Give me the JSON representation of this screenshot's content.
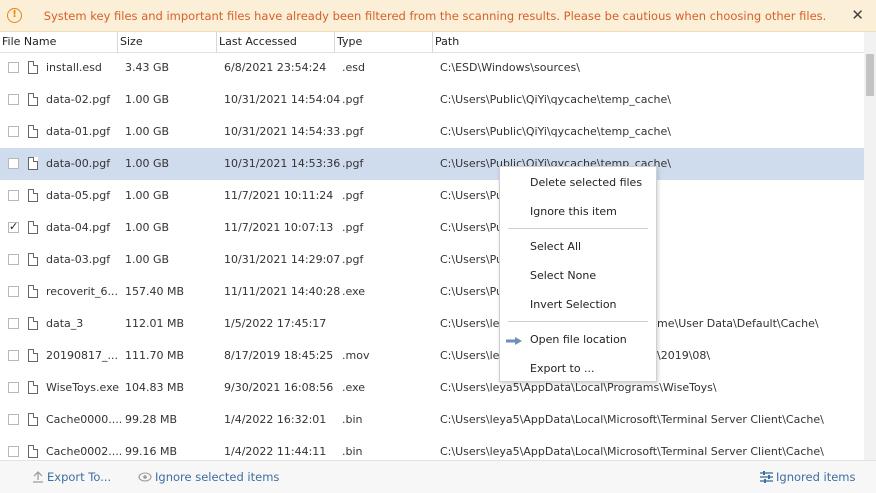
{
  "banner": {
    "icon": "warning-icon",
    "message": "System key files and important files have already been filtered from the scanning results. Please be cautious when choosing other files.",
    "close": "✕"
  },
  "columns": [
    "File Name",
    "Size",
    "Last Accessed",
    "Type",
    "Path"
  ],
  "rows": [
    {
      "name": "install.esd",
      "size": "3.43 GB",
      "date": "6/8/2021 23:54:24",
      "type": ".esd",
      "path": "C:\\ESD\\Windows\\sources\\",
      "checked": false
    },
    {
      "name": "data-02.pgf",
      "size": "1.00 GB",
      "date": "10/31/2021 14:54:04",
      "type": ".pgf",
      "path": "C:\\Users\\Public\\QiYi\\qycache\\temp_cache\\",
      "checked": false
    },
    {
      "name": "data-01.pgf",
      "size": "1.00 GB",
      "date": "10/31/2021 14:54:33",
      "type": ".pgf",
      "path": "C:\\Users\\Public\\QiYi\\qycache\\temp_cache\\",
      "checked": false
    },
    {
      "name": "data-00.pgf",
      "size": "1.00 GB",
      "date": "10/31/2021 14:53:36",
      "type": ".pgf",
      "path": "C:\\Users\\Public\\QiYi\\qycache\\temp_cache\\",
      "checked": false,
      "selected": true
    },
    {
      "name": "data-05.pgf",
      "size": "1.00 GB",
      "date": "11/7/2021 10:11:24",
      "type": ".pgf",
      "path": "C:\\Users\\Publ",
      "checked": false
    },
    {
      "name": "data-04.pgf",
      "size": "1.00 GB",
      "date": "11/7/2021 10:07:13",
      "type": ".pgf",
      "path": "C:\\Users\\Publ",
      "checked": true
    },
    {
      "name": "data-03.pgf",
      "size": "1.00 GB",
      "date": "10/31/2021 14:29:07",
      "type": ".pgf",
      "path": "C:\\Users\\Publ",
      "checked": false
    },
    {
      "name": "recoverit_6...",
      "size": "157.40 MB",
      "date": "11/11/2021 14:40:28",
      "type": ".exe",
      "path": "C:\\Users\\Publ",
      "checked": false
    },
    {
      "name": "data_3",
      "size": "112.01 MB",
      "date": "1/5/2022 17:45:17",
      "type": "",
      "path": "C:\\Users\\leya",
      "path_tail": "me\\User Data\\Default\\Cache\\",
      "checked": false
    },
    {
      "name": "20190817_...",
      "size": "111.70 MB",
      "date": "8/17/2019 18:45:25",
      "type": ".mov",
      "path": "C:\\Users\\leya",
      "path_tail": "\\2019\\08\\",
      "checked": false
    },
    {
      "name": "WiseToys.exe",
      "size": "104.83 MB",
      "date": "9/30/2021 16:08:56",
      "type": ".exe",
      "path": "C:\\Users\\leya5\\AppData\\Local\\Programs\\WiseToys\\",
      "checked": false
    },
    {
      "name": "Cache0000....",
      "size": "99.28 MB",
      "date": "1/4/2022 16:32:01",
      "type": ".bin",
      "path": "C:\\Users\\leya5\\AppData\\Local\\Microsoft\\Terminal Server Client\\Cache\\",
      "checked": false
    },
    {
      "name": "Cache0002....",
      "size": "99.16 MB",
      "date": "1/4/2022 11:44:11",
      "type": ".bin",
      "path": "C:\\Users\\leya5\\AppData\\Local\\Microsoft\\Terminal Server Client\\Cache\\",
      "checked": false
    }
  ],
  "context_menu": {
    "items": [
      "Delete selected files",
      "Ignore this item",
      "Select All",
      "Select None",
      "Invert Selection",
      "Open file location",
      "Export to ..."
    ],
    "arrow_icon": "arrow-right-icon"
  },
  "footer": {
    "export": "Export To...",
    "ignore_selected": "Ignore selected items",
    "ignored_items": "Ignored items"
  },
  "colors": {
    "banner_bg": "#fcefd7",
    "banner_text": "#d4602a",
    "selected_row": "#cfdcee",
    "link": "#3d6ea3"
  }
}
